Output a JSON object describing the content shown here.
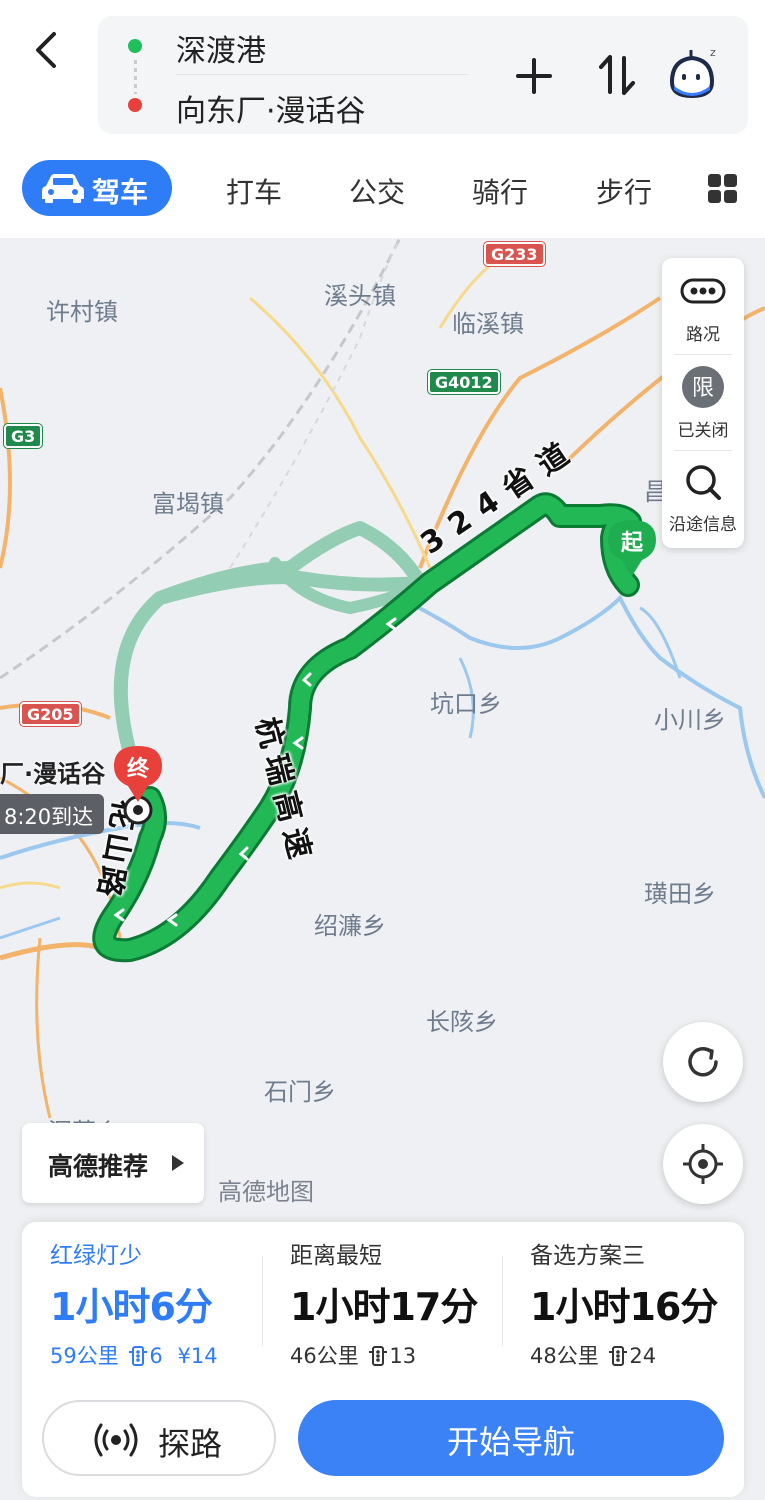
{
  "header": {
    "start": "深渡港",
    "destination": "向东厂·漫话谷"
  },
  "modes": [
    {
      "label": "驾车",
      "active": true
    },
    {
      "label": "打车",
      "active": false
    },
    {
      "label": "公交",
      "active": false
    },
    {
      "label": "骑行",
      "active": false
    },
    {
      "label": "步行",
      "active": false
    }
  ],
  "map": {
    "towns": [
      "许村镇",
      "溪头镇",
      "临溪镇",
      "富堨镇",
      "坑口乡",
      "小川乡",
      "璜田乡",
      "绍濂乡",
      "长陔乡",
      "石门乡",
      "昌",
      "深蕉乡"
    ],
    "highways": {
      "g233": "G233",
      "g4012": "G4012",
      "g3": "G3",
      "g205": "G205"
    },
    "route_labels": {
      "provincial": "324省道",
      "hangrui": "杭瑞高速",
      "huashan": "花山路"
    },
    "panel": {
      "traffic": "路况",
      "restriction_glyph": "限",
      "restriction": "已关闭",
      "search_glyph": "Q",
      "along_route": "沿途信息"
    },
    "pin_end": "终",
    "pin_start": "起",
    "dest_label": "厂·漫话谷",
    "eta": "8:20到达",
    "recommend": "高德推荐",
    "watermark": "高德地图"
  },
  "routes": [
    {
      "tag": "红绿灯少",
      "duration": "1小时6分",
      "distance": "59公里",
      "lights": "6",
      "toll": "¥14",
      "active": true
    },
    {
      "tag": "距离最短",
      "duration": "1小时17分",
      "distance": "46公里",
      "lights": "13",
      "active": false
    },
    {
      "tag": "备选方案三",
      "duration": "1小时16分",
      "distance": "48公里",
      "lights": "24",
      "active": false
    }
  ],
  "actions": {
    "explore": "探路",
    "start_nav": "开始导航"
  },
  "colors": {
    "accent": "#2f7df6",
    "route": "#1fae4f",
    "route_alt": "#93cdb4",
    "start_dot": "#1fbf5c",
    "end_dot": "#e8403b"
  }
}
